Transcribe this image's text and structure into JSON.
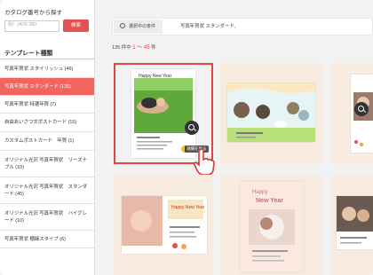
{
  "sidebar": {
    "catalog_search_title": "カタログ番号から探す",
    "catalog_input_placeholder": "例）JATK-280",
    "catalog_search_button": "検索",
    "template_types_title": "テンプレート種類",
    "items": [
      {
        "label": "写真年賀状 スタイリッシュ (46)"
      },
      {
        "label": "写真年賀状 スタンダード (135)"
      },
      {
        "label": "写真年賀状 特選年賀 (7)"
      },
      {
        "label": "自由あいさつ文ポストカード (15)"
      },
      {
        "label": "カスタムポストカード　年賀 (1)"
      },
      {
        "label": "オリジナル光沢 写真年賀状　リーズナブル (10)"
      },
      {
        "label": "オリジナル光沢 写真年賀状　スタンダード (45)"
      },
      {
        "label": "オリジナル光沢 写真年賀状　ハイグレード (10)"
      },
      {
        "label": "写真年賀状 棚繰スタイプ (6)"
      }
    ]
  },
  "search_bar": {
    "condition_label": "選択中の条件",
    "condition_value": "写真年賀状 スタンダード、"
  },
  "results": {
    "total_text": "135 件中",
    "range_text": "1 〜 45",
    "suffix_text": "件"
  },
  "preview": {
    "zoom_label": "詳細を見る"
  },
  "colors": {
    "accent": "#f1655e",
    "selected_border": "#e04646",
    "card_bg": "#f8ece0",
    "count_red": "#e4402f"
  }
}
